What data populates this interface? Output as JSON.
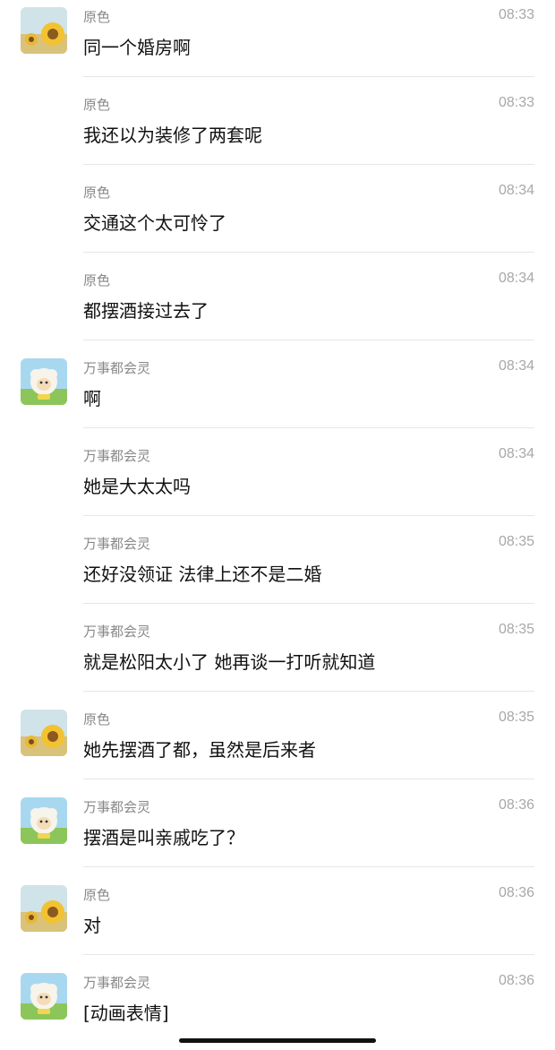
{
  "messages": [
    {
      "sender": "原色",
      "time": "08:33",
      "text": "同一个婚房啊",
      "avatar": "sunflower-avatar"
    },
    {
      "sender": "原色",
      "time": "08:33",
      "text": "我还以为装修了两套呢",
      "avatar": null
    },
    {
      "sender": "原色",
      "time": "08:34",
      "text": "交通这个太可怜了",
      "avatar": null
    },
    {
      "sender": "原色",
      "time": "08:34",
      "text": "都摆酒接过去了",
      "avatar": null
    },
    {
      "sender": "万事都会灵",
      "time": "08:34",
      "text": "啊",
      "avatar": "sheep-avatar"
    },
    {
      "sender": "万事都会灵",
      "time": "08:34",
      "text": "她是大太太吗",
      "avatar": null
    },
    {
      "sender": "万事都会灵",
      "time": "08:35",
      "text": "还好没领证 法律上还不是二婚",
      "avatar": null
    },
    {
      "sender": "万事都会灵",
      "time": "08:35",
      "text": "就是松阳太小了 她再谈一打听就知道",
      "avatar": null
    },
    {
      "sender": "原色",
      "time": "08:35",
      "text": "她先摆酒了都，虽然是后来者",
      "avatar": "sunflower-avatar"
    },
    {
      "sender": "万事都会灵",
      "time": "08:36",
      "text": "摆酒是叫亲戚吃了？",
      "avatar": "sheep-avatar"
    },
    {
      "sender": "原色",
      "time": "08:36",
      "text": "对",
      "avatar": "sunflower-avatar"
    },
    {
      "sender": "万事都会灵",
      "time": "08:36",
      "text": "[动画表情]",
      "avatar": "sheep-avatar"
    }
  ]
}
